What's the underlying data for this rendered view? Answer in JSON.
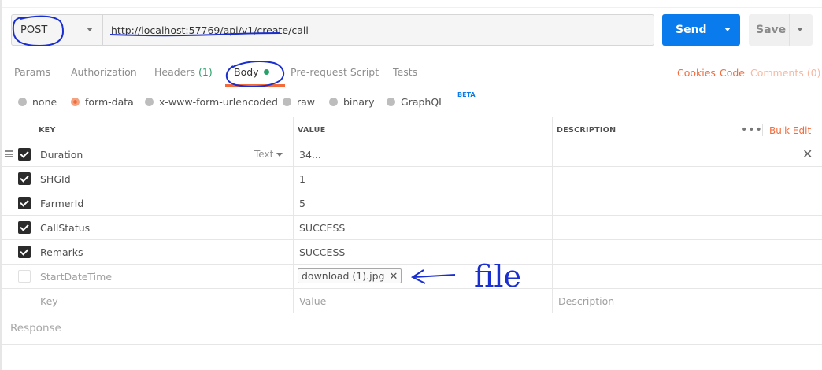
{
  "request": {
    "method": "POST",
    "url": "http://localhost:57769/api/v1/create/call",
    "send_label": "Send",
    "save_label": "Save"
  },
  "tabs": [
    {
      "label": "Params"
    },
    {
      "label": "Authorization"
    },
    {
      "label": "Headers",
      "count": "(1)"
    },
    {
      "label": "Body"
    },
    {
      "label": "Pre-request Script"
    },
    {
      "label": "Tests"
    }
  ],
  "right_links": {
    "cookies": "Cookies",
    "code": "Code",
    "comments": "Comments (0)"
  },
  "body_types": [
    {
      "label": "none"
    },
    {
      "label": "form-data",
      "selected": true
    },
    {
      "label": "x-www-form-urlencoded"
    },
    {
      "label": "raw"
    },
    {
      "label": "binary"
    },
    {
      "label": "GraphQL",
      "badge": "BETA"
    }
  ],
  "table": {
    "headers": {
      "key": "KEY",
      "value": "VALUE",
      "description": "DESCRIPTION"
    },
    "bulk_edit": "Bulk Edit",
    "rows": [
      {
        "key": "Duration",
        "type": "Text",
        "value": "34...",
        "checked": true
      },
      {
        "key": "SHGId",
        "value": "1",
        "checked": true
      },
      {
        "key": "FarmerId",
        "value": "5",
        "checked": true
      },
      {
        "key": "CallStatus",
        "value": "SUCCESS",
        "checked": true
      },
      {
        "key": "Remarks",
        "value": "SUCCESS",
        "checked": true
      },
      {
        "key": "StartDateTime",
        "file": "download (1).jpg",
        "checked": false
      }
    ],
    "placeholders": {
      "key": "Key",
      "value": "Value",
      "description": "Description"
    }
  },
  "response_label": "Response",
  "annotation_text": "file",
  "colors": {
    "accent": "#f26b3a",
    "send": "#097bed",
    "green": "#27a168",
    "ink": "#1a2fd0"
  }
}
